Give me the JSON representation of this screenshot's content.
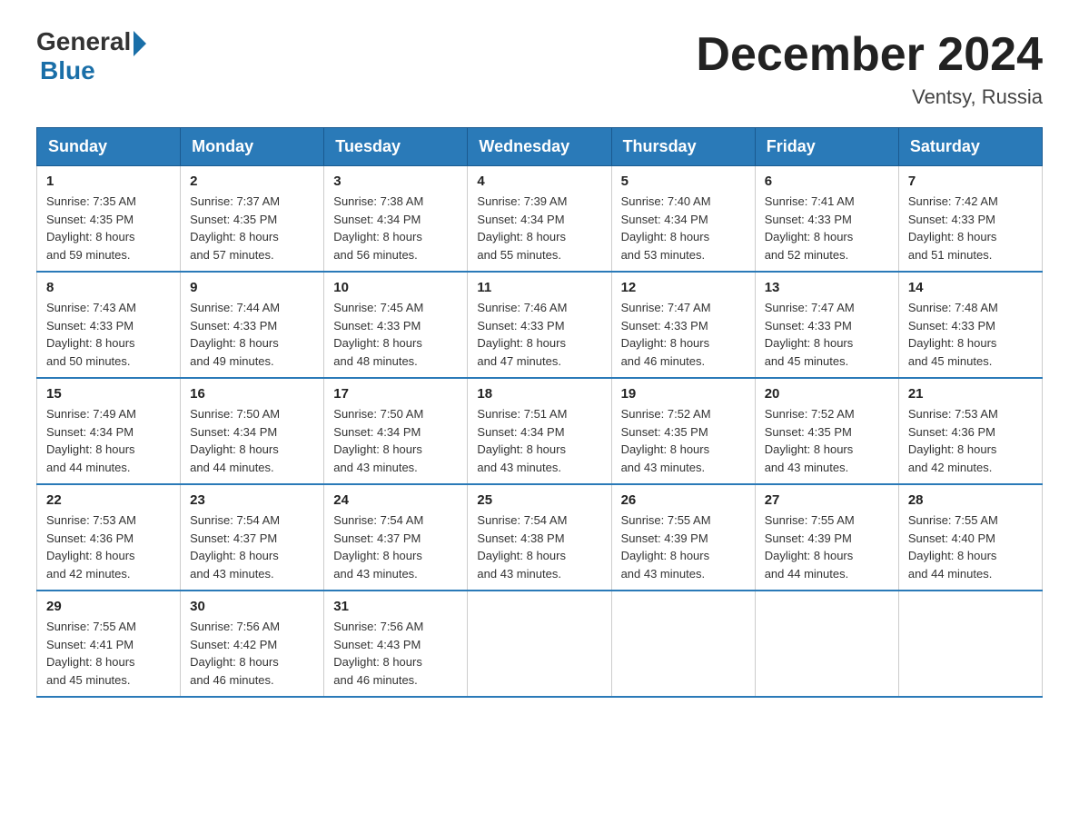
{
  "header": {
    "logo_general": "General",
    "logo_blue": "Blue",
    "month_title": "December 2024",
    "location": "Ventsy, Russia"
  },
  "days_of_week": [
    "Sunday",
    "Monday",
    "Tuesday",
    "Wednesday",
    "Thursday",
    "Friday",
    "Saturday"
  ],
  "weeks": [
    [
      {
        "day": "1",
        "sunrise": "7:35 AM",
        "sunset": "4:35 PM",
        "daylight": "8 hours and 59 minutes."
      },
      {
        "day": "2",
        "sunrise": "7:37 AM",
        "sunset": "4:35 PM",
        "daylight": "8 hours and 57 minutes."
      },
      {
        "day": "3",
        "sunrise": "7:38 AM",
        "sunset": "4:34 PM",
        "daylight": "8 hours and 56 minutes."
      },
      {
        "day": "4",
        "sunrise": "7:39 AM",
        "sunset": "4:34 PM",
        "daylight": "8 hours and 55 minutes."
      },
      {
        "day": "5",
        "sunrise": "7:40 AM",
        "sunset": "4:34 PM",
        "daylight": "8 hours and 53 minutes."
      },
      {
        "day": "6",
        "sunrise": "7:41 AM",
        "sunset": "4:33 PM",
        "daylight": "8 hours and 52 minutes."
      },
      {
        "day": "7",
        "sunrise": "7:42 AM",
        "sunset": "4:33 PM",
        "daylight": "8 hours and 51 minutes."
      }
    ],
    [
      {
        "day": "8",
        "sunrise": "7:43 AM",
        "sunset": "4:33 PM",
        "daylight": "8 hours and 50 minutes."
      },
      {
        "day": "9",
        "sunrise": "7:44 AM",
        "sunset": "4:33 PM",
        "daylight": "8 hours and 49 minutes."
      },
      {
        "day": "10",
        "sunrise": "7:45 AM",
        "sunset": "4:33 PM",
        "daylight": "8 hours and 48 minutes."
      },
      {
        "day": "11",
        "sunrise": "7:46 AM",
        "sunset": "4:33 PM",
        "daylight": "8 hours and 47 minutes."
      },
      {
        "day": "12",
        "sunrise": "7:47 AM",
        "sunset": "4:33 PM",
        "daylight": "8 hours and 46 minutes."
      },
      {
        "day": "13",
        "sunrise": "7:47 AM",
        "sunset": "4:33 PM",
        "daylight": "8 hours and 45 minutes."
      },
      {
        "day": "14",
        "sunrise": "7:48 AM",
        "sunset": "4:33 PM",
        "daylight": "8 hours and 45 minutes."
      }
    ],
    [
      {
        "day": "15",
        "sunrise": "7:49 AM",
        "sunset": "4:34 PM",
        "daylight": "8 hours and 44 minutes."
      },
      {
        "day": "16",
        "sunrise": "7:50 AM",
        "sunset": "4:34 PM",
        "daylight": "8 hours and 44 minutes."
      },
      {
        "day": "17",
        "sunrise": "7:50 AM",
        "sunset": "4:34 PM",
        "daylight": "8 hours and 43 minutes."
      },
      {
        "day": "18",
        "sunrise": "7:51 AM",
        "sunset": "4:34 PM",
        "daylight": "8 hours and 43 minutes."
      },
      {
        "day": "19",
        "sunrise": "7:52 AM",
        "sunset": "4:35 PM",
        "daylight": "8 hours and 43 minutes."
      },
      {
        "day": "20",
        "sunrise": "7:52 AM",
        "sunset": "4:35 PM",
        "daylight": "8 hours and 43 minutes."
      },
      {
        "day": "21",
        "sunrise": "7:53 AM",
        "sunset": "4:36 PM",
        "daylight": "8 hours and 42 minutes."
      }
    ],
    [
      {
        "day": "22",
        "sunrise": "7:53 AM",
        "sunset": "4:36 PM",
        "daylight": "8 hours and 42 minutes."
      },
      {
        "day": "23",
        "sunrise": "7:54 AM",
        "sunset": "4:37 PM",
        "daylight": "8 hours and 43 minutes."
      },
      {
        "day": "24",
        "sunrise": "7:54 AM",
        "sunset": "4:37 PM",
        "daylight": "8 hours and 43 minutes."
      },
      {
        "day": "25",
        "sunrise": "7:54 AM",
        "sunset": "4:38 PM",
        "daylight": "8 hours and 43 minutes."
      },
      {
        "day": "26",
        "sunrise": "7:55 AM",
        "sunset": "4:39 PM",
        "daylight": "8 hours and 43 minutes."
      },
      {
        "day": "27",
        "sunrise": "7:55 AM",
        "sunset": "4:39 PM",
        "daylight": "8 hours and 44 minutes."
      },
      {
        "day": "28",
        "sunrise": "7:55 AM",
        "sunset": "4:40 PM",
        "daylight": "8 hours and 44 minutes."
      }
    ],
    [
      {
        "day": "29",
        "sunrise": "7:55 AM",
        "sunset": "4:41 PM",
        "daylight": "8 hours and 45 minutes."
      },
      {
        "day": "30",
        "sunrise": "7:56 AM",
        "sunset": "4:42 PM",
        "daylight": "8 hours and 46 minutes."
      },
      {
        "day": "31",
        "sunrise": "7:56 AM",
        "sunset": "4:43 PM",
        "daylight": "8 hours and 46 minutes."
      },
      null,
      null,
      null,
      null
    ]
  ]
}
